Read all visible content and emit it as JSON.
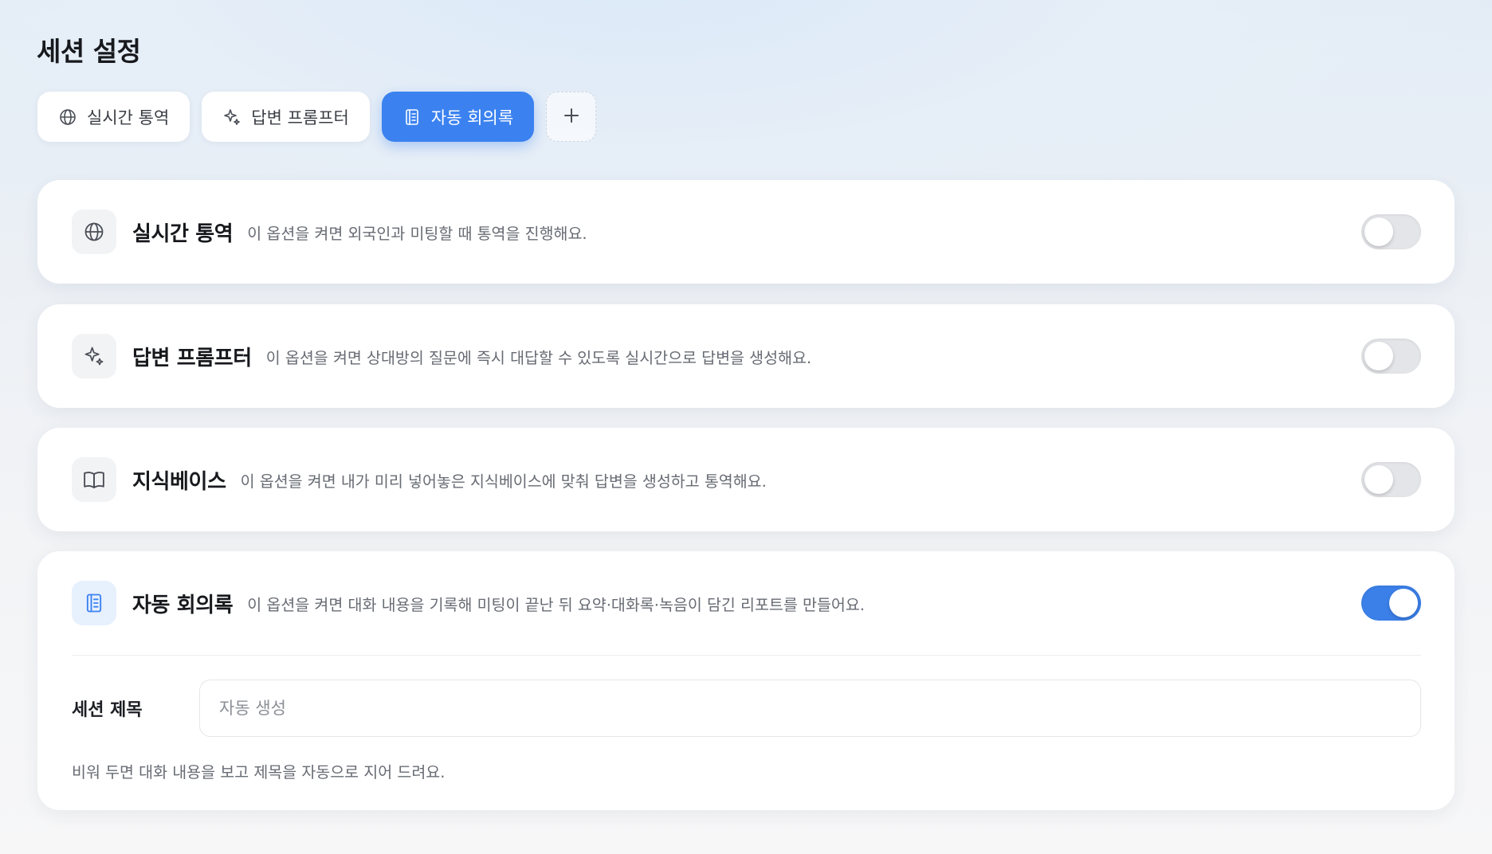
{
  "page": {
    "title": "세션 설정"
  },
  "tabs": [
    {
      "label": "실시간 통역",
      "icon": "globe-icon",
      "active": false
    },
    {
      "label": "답변 프롬프터",
      "icon": "sparkle-icon",
      "active": false
    },
    {
      "label": "자동 회의록",
      "icon": "document-icon",
      "active": true
    }
  ],
  "tab_add": {
    "icon": "plus-icon"
  },
  "options": [
    {
      "title": "실시간 통역",
      "description": "이 옵션을 켜면 외국인과 미팅할 때 통역을 진행해요.",
      "icon": "globe-icon",
      "enabled": false
    },
    {
      "title": "답변 프롬프터",
      "description": "이 옵션을 켜면 상대방의 질문에 즉시 대답할 수 있도록 실시간으로 답변을 생성해요.",
      "icon": "sparkle-icon",
      "enabled": false
    },
    {
      "title": "지식베이스",
      "description": "이 옵션을 켜면 내가 미리 넣어놓은 지식베이스에 맞춰 답변을 생성하고 통역해요.",
      "icon": "book-icon",
      "enabled": false
    },
    {
      "title": "자동 회의록",
      "description": "이 옵션을 켜면 대화 내용을 기록해 미팅이 끝난 뒤 요약·대화록·녹음이 담긴 리포트를 만들어요.",
      "icon": "document-icon",
      "enabled": true
    }
  ],
  "session_title": {
    "label": "세션 제목",
    "value": "",
    "placeholder": "자동 생성",
    "help": "비워 두면 대화 내용을 보고 제목을 자동으로 지어 드려요."
  },
  "colors": {
    "accent": "#3b82f0",
    "toggle_on": "#3b7fe8",
    "toggle_off": "#e4e5e8"
  }
}
